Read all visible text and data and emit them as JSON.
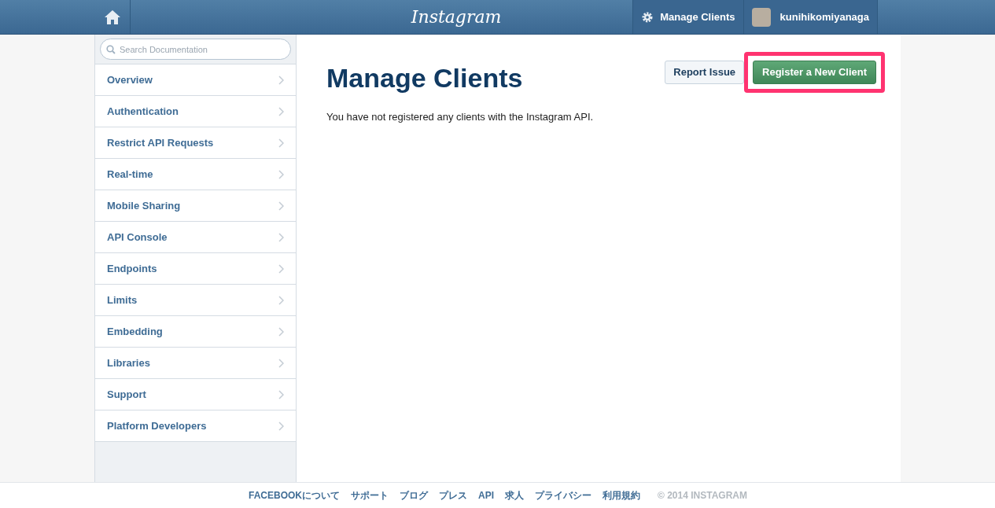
{
  "header": {
    "logo": "Instagram",
    "nav": [
      {
        "label": "Manage Clients",
        "kind": "settings"
      },
      {
        "label": "kunihikomiyanaga",
        "kind": "user"
      }
    ]
  },
  "sidebar": {
    "search": {
      "placeholder": "Search Documentation"
    },
    "items": [
      {
        "label": "Overview"
      },
      {
        "label": "Authentication"
      },
      {
        "label": "Restrict API Requests"
      },
      {
        "label": "Real-time"
      },
      {
        "label": "Mobile Sharing"
      },
      {
        "label": "API Console"
      },
      {
        "label": "Endpoints"
      },
      {
        "label": "Limits"
      },
      {
        "label": "Embedding"
      },
      {
        "label": "Libraries"
      },
      {
        "label": "Support"
      },
      {
        "label": "Platform Developers"
      }
    ]
  },
  "main": {
    "title": "Manage Clients",
    "buttons": [
      {
        "label": "Report Issue",
        "kind": "secondary",
        "highlighted": false
      },
      {
        "label": "Register a New Client",
        "kind": "primary",
        "highlighted": true
      }
    ],
    "message": "You have not registered any clients with the Instagram API."
  },
  "footer": {
    "links": [
      "FACEBOOKについて",
      "サポート",
      "ブログ",
      "プレス",
      "API",
      "求人",
      "プライバシー",
      "利用規約"
    ],
    "copyright": "© 2014 INSTAGRAM"
  }
}
